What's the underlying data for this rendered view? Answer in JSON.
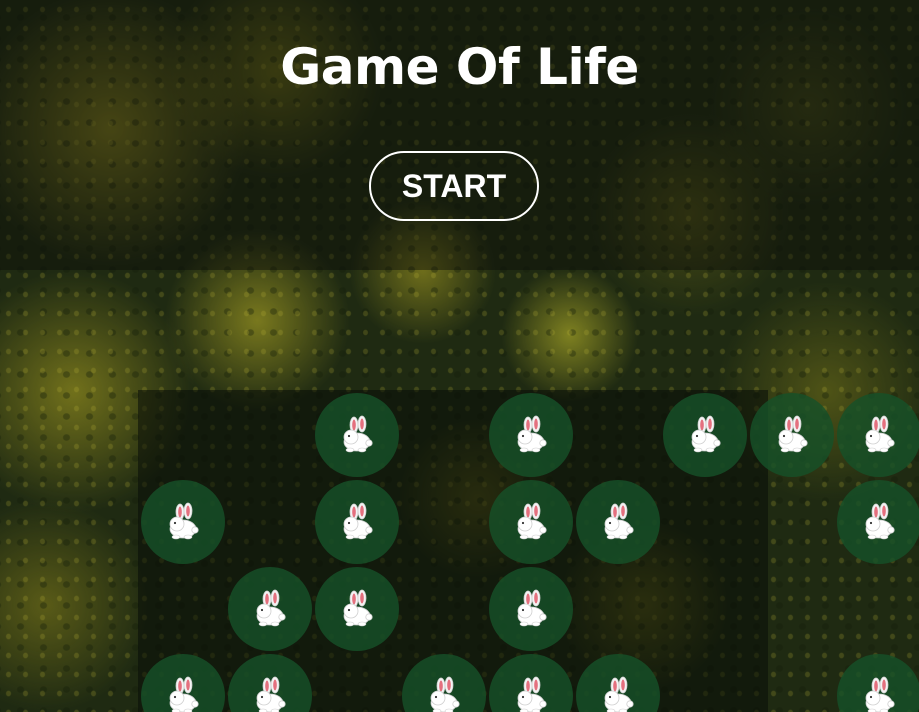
{
  "title": "Game Of Life",
  "start_label": "START",
  "cell_icon": "rabbit-icon",
  "colors": {
    "cell_fill": "#165028",
    "text": "#ffffff",
    "rabbit_ear": "#e4707e"
  },
  "alive_cells": [
    {
      "row": 0,
      "col": 2
    },
    {
      "row": 0,
      "col": 4
    },
    {
      "row": 0,
      "col": 6
    },
    {
      "row": 0,
      "col": 7
    },
    {
      "row": 0,
      "col": 8
    },
    {
      "row": 1,
      "col": 0
    },
    {
      "row": 1,
      "col": 2
    },
    {
      "row": 1,
      "col": 4
    },
    {
      "row": 1,
      "col": 5
    },
    {
      "row": 1,
      "col": 8
    },
    {
      "row": 2,
      "col": 1
    },
    {
      "row": 2,
      "col": 2
    },
    {
      "row": 2,
      "col": 4
    },
    {
      "row": 3,
      "col": 0
    },
    {
      "row": 3,
      "col": 1
    },
    {
      "row": 3,
      "col": 3
    },
    {
      "row": 3,
      "col": 4
    },
    {
      "row": 3,
      "col": 5
    },
    {
      "row": 3,
      "col": 8
    }
  ]
}
